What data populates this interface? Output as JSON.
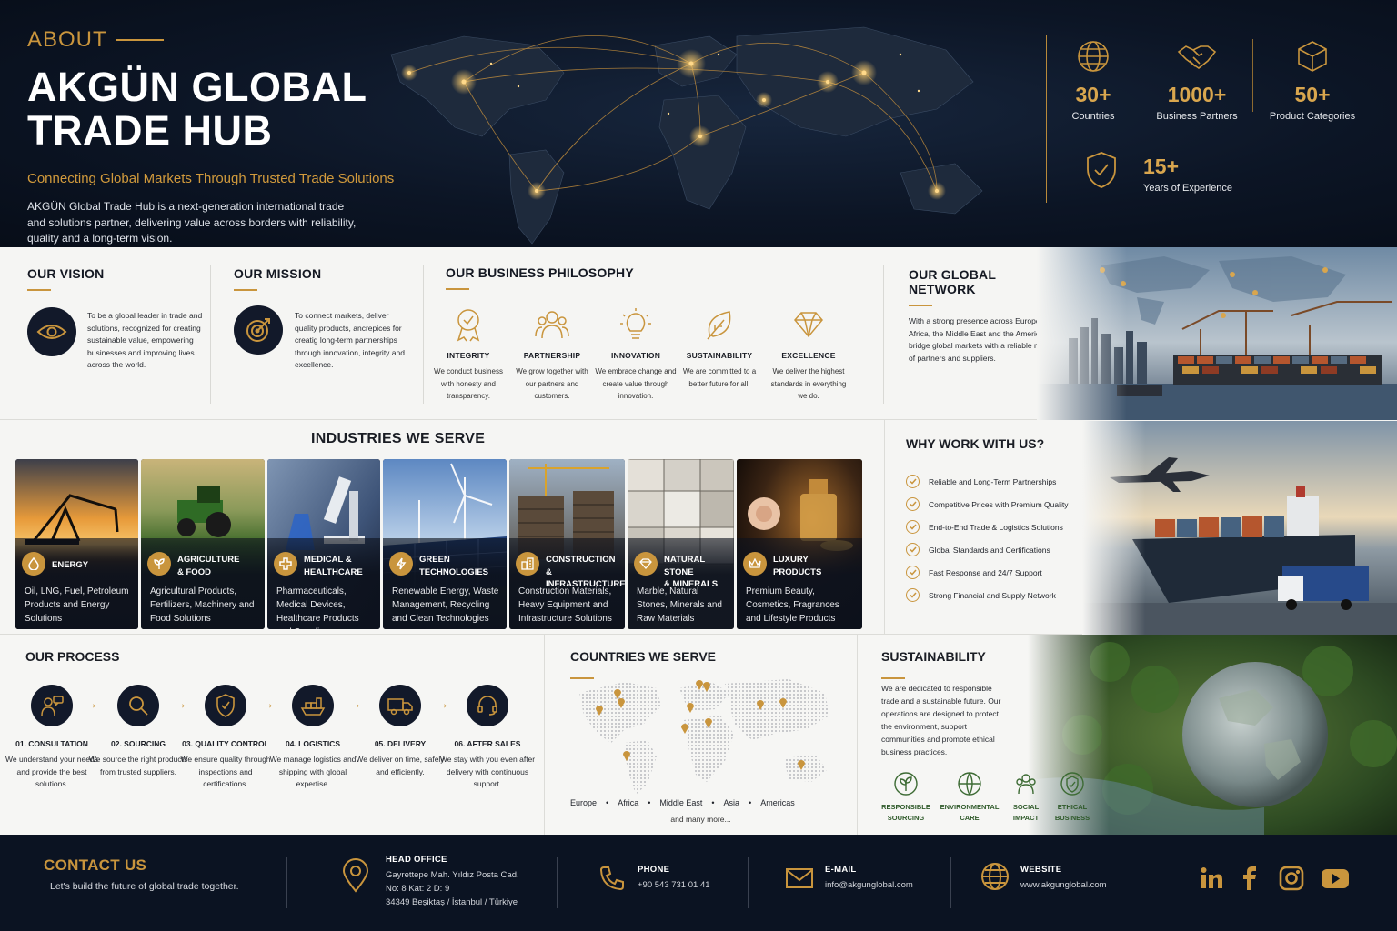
{
  "hero": {
    "eyebrow": "ABOUT",
    "title_line1": "AKGÜN GLOBAL",
    "title_line2": "TRADE HUB",
    "subtitle": "Connecting Global Markets Through Trusted Trade Solutions",
    "description": "AKGÜN Global Trade Hub is a next-generation international trade and solutions partner, delivering value across borders with reliability, quality and a long-term vision."
  },
  "stats": [
    {
      "icon": "globe-icon",
      "value": "30+",
      "label": "Countries"
    },
    {
      "icon": "handshake-icon",
      "value": "1000+",
      "label": "Business Partners"
    },
    {
      "icon": "box-icon",
      "value": "50+",
      "label": "Product Categories"
    },
    {
      "icon": "shield-check-icon",
      "value": "15+",
      "label": "Years of Experience"
    }
  ],
  "vision": {
    "title": "OUR VISION",
    "icon": "eye-icon",
    "text": "To be a global leader in trade and solutions, recognized for creating sustainable value, empowering businesses and improving lives across the world."
  },
  "mission": {
    "title": "OUR MISSION",
    "icon": "target-icon",
    "text": "To connect markets, deliver quality products, ancrepices for creatig long-term partnerships through innovation, integrity and excellence."
  },
  "philosophy": {
    "title": "OUR BUSINESS PHILOSOPHY",
    "items": [
      {
        "icon": "medal-icon",
        "title": "INTEGRITY",
        "text": "We conduct business with honesty and transparency."
      },
      {
        "icon": "people-icon",
        "title": "PARTNERSHIP",
        "text": "We grow together with our partners and customers."
      },
      {
        "icon": "lightbulb-icon",
        "title": "INNOVATION",
        "text": "We embrace change and create value through innovation."
      },
      {
        "icon": "leaf-icon",
        "title": "SUSTAINABILITY",
        "text": "We are committed to a better future for all."
      },
      {
        "icon": "diamond-icon",
        "title": "EXCELLENCE",
        "text": "We deliver the highest standards in everything we do."
      }
    ]
  },
  "network": {
    "title": "OUR GLOBAL NETWORK",
    "text": "With a strong presence across Europe, Asia, Africa, the Middle East and the Americas, we bridge global markets with a reliable network of partners and suppliers."
  },
  "industries": {
    "title": "INDUSTRIES WE SERVE",
    "items": [
      {
        "icon": "drop-icon",
        "name_line1": "ENERGY",
        "name_line2": "",
        "text": "Oil, LNG, Fuel, Petroleum Products and Energy Solutions"
      },
      {
        "icon": "sprout-icon",
        "name_line1": "AGRICULTURE",
        "name_line2": "& FOOD",
        "text": "Agricultural Products, Fertilizers, Machinery and Food Solutions"
      },
      {
        "icon": "medical-cross-icon",
        "name_line1": "MEDICAL &",
        "name_line2": "HEALTHCARE",
        "text": "Pharmaceuticals, Medical Devices, Healthcare Products and Supplies"
      },
      {
        "icon": "bolt-icon",
        "name_line1": "GREEN",
        "name_line2": "TECHNOLOGIES",
        "text": "Renewable Energy, Waste Management, Recycling and Clean Technologies"
      },
      {
        "icon": "building-icon",
        "name_line1": "CONSTRUCTION",
        "name_line2": "& INFRASTRUCTURE",
        "text": "Construction Materials, Heavy Equipment and Infrastructure Solutions"
      },
      {
        "icon": "gem-icon",
        "name_line1": "NATURAL STONE",
        "name_line2": "& MINERALS",
        "text": "Marble, Natural Stones, Minerals and Raw Materials"
      },
      {
        "icon": "crown-icon",
        "name_line1": "LUXURY",
        "name_line2": "PRODUCTS",
        "text": "Premium Beauty, Cosmetics, Fragrances and Lifestyle Products"
      }
    ]
  },
  "why": {
    "title": "WHY WORK WITH US?",
    "items": [
      "Reliable and Long-Term Partnerships",
      "Competitive Prices with Premium Quality",
      "End-to-End Trade & Logistics Solutions",
      "Global Standards and Certifications",
      "Fast Response and 24/7 Support",
      "Strong Financial and Supply Network"
    ]
  },
  "process": {
    "title": "OUR PROCESS",
    "steps": [
      {
        "icon": "consultation-icon",
        "title": "01. CONSULTATION",
        "text": "We understand your needs and provide the best solutions."
      },
      {
        "icon": "search-icon",
        "title": "02. SOURCING",
        "text": "We source the right products from trusted suppliers."
      },
      {
        "icon": "shield-check-icon",
        "title": "03. QUALITY CONTROL",
        "text": "We ensure quality through inspections and certifications."
      },
      {
        "icon": "ship-icon",
        "title": "04. LOGISTICS",
        "text": "We manage logistics and shipping with global expertise."
      },
      {
        "icon": "truck-icon",
        "title": "05. DELIVERY",
        "text": "We deliver on time, safely and efficiently."
      },
      {
        "icon": "headset-icon",
        "title": "06. AFTER SALES",
        "text": "We stay with you even after delivery with continuous support."
      }
    ]
  },
  "countries": {
    "title": "COUNTRIES WE SERVE",
    "regions": [
      "Europe",
      "Africa",
      "Middle East",
      "Asia",
      "Americas"
    ],
    "more": "and many more..."
  },
  "sustainability": {
    "title": "SUSTAINABILITY",
    "text": "We are dedicated to responsible trade and a sustainable future. Our operations are designed to protect the environment, support communities and promote ethical business practices.",
    "items": [
      {
        "icon": "sprout-icon",
        "line1": "RESPONSIBLE",
        "line2": "SOURCING"
      },
      {
        "icon": "globe-leaf-icon",
        "line1": "ENVIRONMENTAL",
        "line2": "CARE"
      },
      {
        "icon": "community-icon",
        "line1": "SOCIAL",
        "line2": "IMPACT"
      },
      {
        "icon": "shield-leaf-icon",
        "line1": "ETHICAL",
        "line2": "BUSINESS"
      }
    ]
  },
  "footer": {
    "contact_title": "CONTACT US",
    "tagline": "Let's build the future of global trade together.",
    "office_label": "HEAD OFFICE",
    "office_line1": "Gayrettepe Mah. Yıldız Posta Cad.",
    "office_line2": "No: 8 Kat: 2 D: 9",
    "office_line3": "34349 Beşiktaş / İstanbul / Türkiye",
    "phone_label": "PHONE",
    "phone": "+90 543 731 01 41",
    "email_label": "E-MAIL",
    "email": "info@akgunglobal.com",
    "website_label": "WEBSITE",
    "website": "www.akgunglobal.com",
    "social": [
      "linkedin-icon",
      "facebook-icon",
      "instagram-icon",
      "youtube-icon"
    ]
  },
  "colors": {
    "gold": "#c9953d",
    "navy": "#0b1322",
    "background": "#f5f5f3"
  }
}
